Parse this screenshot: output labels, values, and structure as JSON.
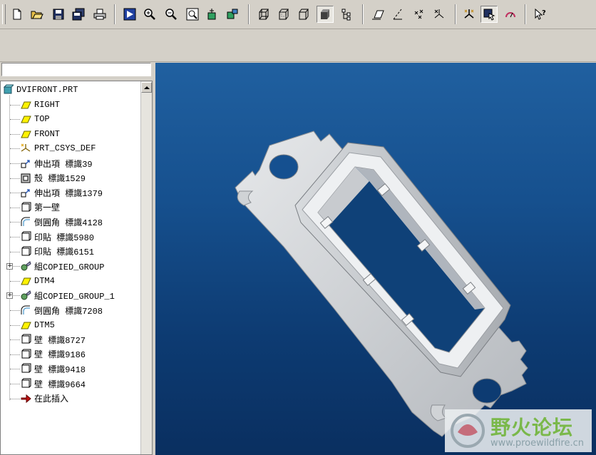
{
  "toolbar": {
    "buttons": [
      {
        "name": "new-file",
        "icon": "new-file-icon"
      },
      {
        "name": "open-file",
        "icon": "open-folder-icon"
      },
      {
        "name": "save",
        "icon": "save-icon"
      },
      {
        "name": "save-copy",
        "icon": "save-copy-icon"
      },
      {
        "name": "print",
        "icon": "print-icon"
      },
      {
        "name": "redraw",
        "icon": "redraw-icon"
      },
      {
        "name": "zoom-in",
        "icon": "zoom-in-icon"
      },
      {
        "name": "zoom-out",
        "icon": "zoom-out-icon"
      },
      {
        "name": "refit",
        "icon": "refit-icon"
      },
      {
        "name": "reorient",
        "icon": "reorient-icon"
      },
      {
        "name": "saved-views",
        "icon": "saved-views-icon"
      },
      {
        "name": "wireframe",
        "icon": "wireframe-icon"
      },
      {
        "name": "hidden-line",
        "icon": "hidden-line-icon"
      },
      {
        "name": "no-hidden",
        "icon": "no-hidden-icon"
      },
      {
        "name": "shading",
        "icon": "shading-icon"
      },
      {
        "name": "model-tree",
        "icon": "model-tree-icon"
      },
      {
        "name": "datum-planes",
        "icon": "datum-plane-icon"
      },
      {
        "name": "datum-axes",
        "icon": "datum-axis-icon"
      },
      {
        "name": "datum-points",
        "icon": "datum-point-icon"
      },
      {
        "name": "coordinate-systems",
        "icon": "csys-icon"
      },
      {
        "name": "spin-center",
        "icon": "spin-center-icon"
      },
      {
        "name": "orient-mode",
        "icon": "orient-mode-icon"
      },
      {
        "name": "rotate",
        "icon": "rotate-icon"
      },
      {
        "name": "whats-this",
        "icon": "help-pointer-icon"
      }
    ]
  },
  "model_tree": {
    "root": {
      "label": "DVIFRONT.PRT",
      "icon": "part-icon"
    },
    "items": [
      {
        "label": "RIGHT",
        "icon": "datum-plane-icon"
      },
      {
        "label": "TOP",
        "icon": "datum-plane-icon"
      },
      {
        "label": "FRONT",
        "icon": "datum-plane-icon"
      },
      {
        "label": "PRT_CSYS_DEF",
        "icon": "csys-icon"
      },
      {
        "label": "伸出項 標識39",
        "icon": "extrude-icon"
      },
      {
        "label": "殼 標識1529",
        "icon": "shell-icon"
      },
      {
        "label": "伸出項 標識1379",
        "icon": "extrude-icon"
      },
      {
        "label": "第一壁",
        "icon": "wall-icon"
      },
      {
        "label": "倒圓角 標識4128",
        "icon": "round-icon"
      },
      {
        "label": "印貼 標識5980",
        "icon": "wall-icon"
      },
      {
        "label": "印貼 標識6151",
        "icon": "wall-icon"
      },
      {
        "label": "組COPIED_GROUP",
        "icon": "group-icon",
        "expandable": true
      },
      {
        "label": "DTM4",
        "icon": "datum-plane-icon"
      },
      {
        "label": "組COPIED_GROUP_1",
        "icon": "group-icon",
        "expandable": true
      },
      {
        "label": "倒圓角 標識7208",
        "icon": "round-icon"
      },
      {
        "label": "DTM5",
        "icon": "datum-plane-icon"
      },
      {
        "label": "壁 標識8727",
        "icon": "wall-icon"
      },
      {
        "label": "壁 標識9186",
        "icon": "wall-icon"
      },
      {
        "label": "壁 標識9418",
        "icon": "wall-icon"
      },
      {
        "label": "壁 標識9664",
        "icon": "wall-icon"
      },
      {
        "label": "在此插入",
        "icon": "insert-arrow-icon"
      }
    ]
  },
  "viewport": {
    "background_top": "#2060a0",
    "background_bottom": "#0a2f60",
    "model_color": "#c9cdd2"
  },
  "watermark": {
    "text_cn": "野火论坛",
    "url": "www.proewildfire.cn"
  }
}
